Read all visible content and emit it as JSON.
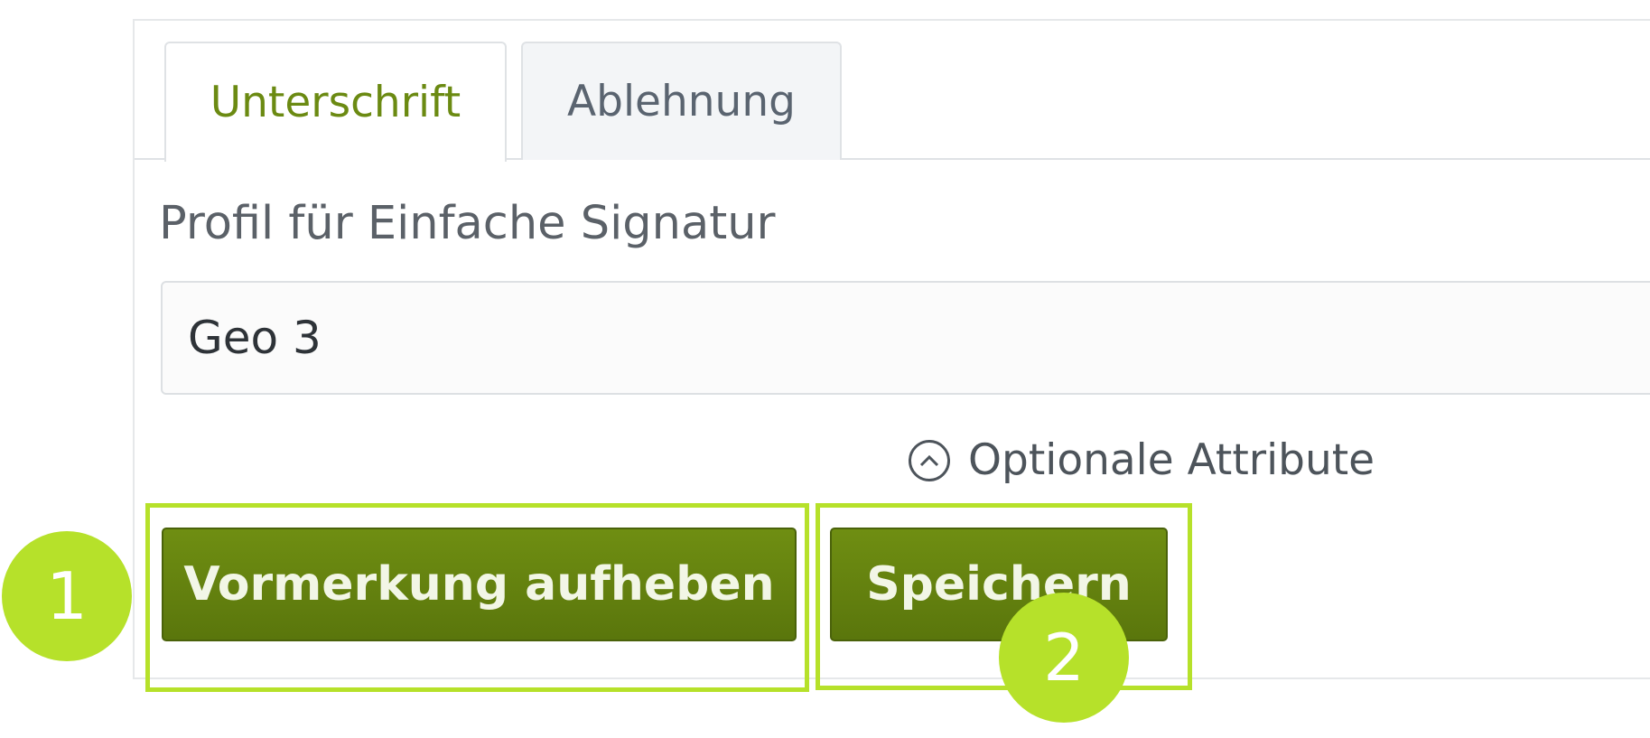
{
  "tabs": [
    {
      "label": "Unterschrift",
      "active": true
    },
    {
      "label": "Ablehnung",
      "active": false
    }
  ],
  "form": {
    "profile_label": "Profil für Einfache Signatur",
    "profile_value": "Geo 3",
    "optional_attributes_label": "Optionale Attribute",
    "optional_attributes_icon": "chevron-up-circle-icon"
  },
  "buttons": {
    "unmark_label": "Vormerkung aufheben",
    "save_label": "Speichern"
  },
  "annotations": {
    "marker_1": "1",
    "marker_2": "2",
    "highlight_color": "#b6e12a"
  },
  "colors": {
    "accent_green": "#6b8a12",
    "button_green": "#647f0f"
  }
}
